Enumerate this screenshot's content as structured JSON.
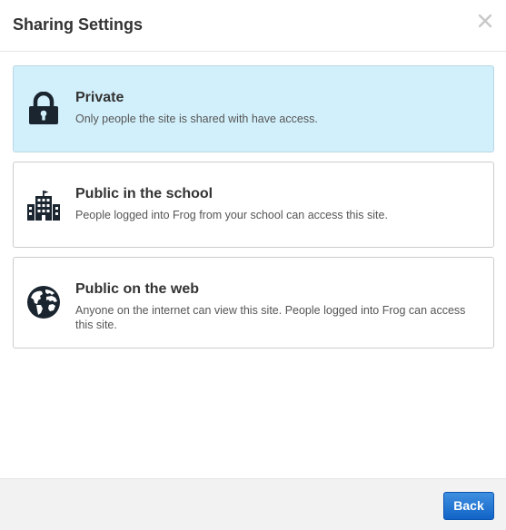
{
  "dialog": {
    "title": "Sharing Settings",
    "close_icon": "close-icon"
  },
  "options": [
    {
      "title": "Private",
      "description": "Only people the site is shared with have access.",
      "icon": "padlock-icon",
      "selected": true
    },
    {
      "title": "Public in the school",
      "description": "People logged into Frog from your school can access this site.",
      "icon": "school-building-icon",
      "selected": false
    },
    {
      "title": "Public on the web",
      "description": "Anyone on the internet can view this site. People logged into Frog can access this site.",
      "icon": "globe-icon",
      "selected": false
    }
  ],
  "footer": {
    "back_label": "Back"
  },
  "colors": {
    "selected_background": "#d2f0fb",
    "button_blue": "#1a73d4",
    "icon_dark": "#1a2530"
  }
}
